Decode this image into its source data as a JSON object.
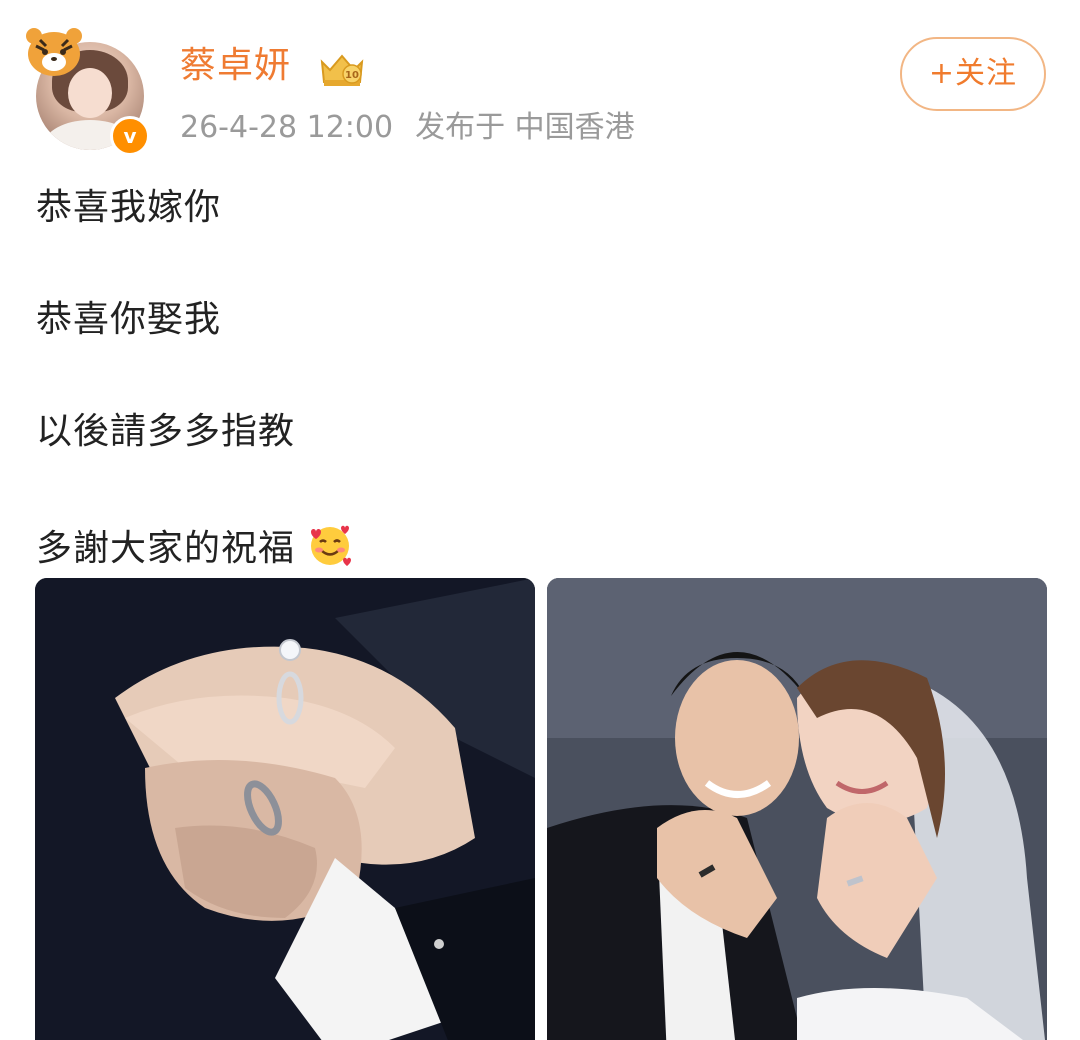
{
  "header": {
    "user_name": "蔡卓妍",
    "timestamp": "26-4-28 12:00",
    "location": "发布于 中国香港",
    "follow_label": "+关注",
    "verified_mark": "v",
    "member_level": "10"
  },
  "post": {
    "lines": [
      "恭喜我嫁你",
      "恭喜你娶我",
      "以後請多多指教",
      "多謝大家的祝福"
    ],
    "emoji": "smiling-face-with-hearts-icon"
  },
  "photos": [
    {
      "name": "wedding-rings-hands-photo"
    },
    {
      "name": "couple-showing-rings-photo"
    }
  ],
  "colors": {
    "name_orange": "#ef7b32",
    "follow_orange": "#f07b2d",
    "meta_gray": "#9a9a9a",
    "text": "#222222",
    "badge_orange": "#ff8f00"
  }
}
